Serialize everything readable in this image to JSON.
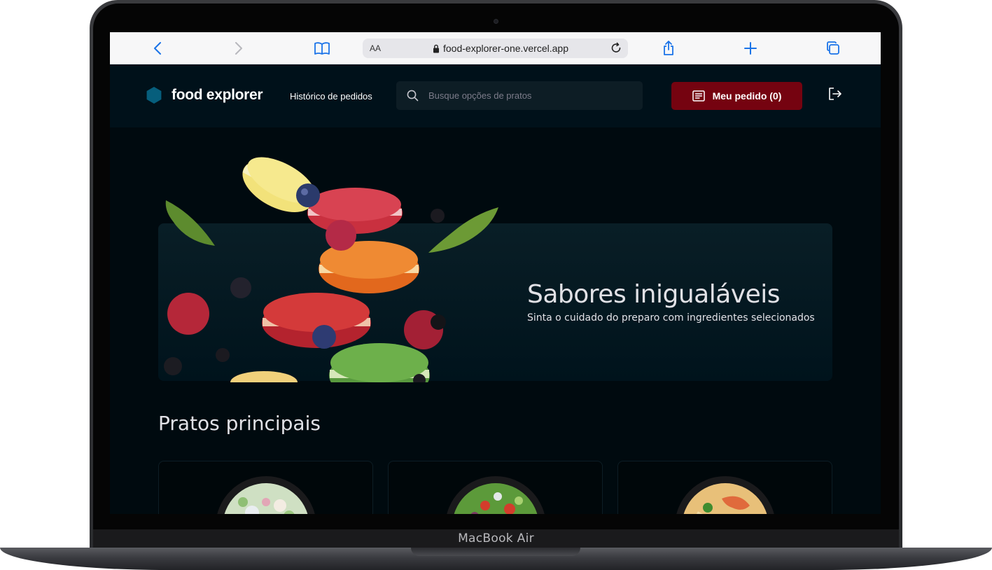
{
  "device": {
    "label": "MacBook Air"
  },
  "browser": {
    "url": "food-explorer-one.vercel.app",
    "text_size_label": "AA",
    "icons": [
      "back-icon",
      "forward-icon",
      "bookmarks-icon",
      "lock-icon",
      "reload-icon",
      "share-icon",
      "new-tab-icon",
      "tabs-icon"
    ]
  },
  "header": {
    "logo_text": "food explorer",
    "nav_history": "Histórico de pedidos",
    "search_placeholder": "Busque opções de pratos",
    "order_button": "Meu pedido (0)"
  },
  "banner": {
    "title": "Sabores inigualáveis",
    "subtitle": "Sinta o cuidado do preparo com ingredientes selecionados"
  },
  "section": {
    "title": "Pratos principais",
    "dishes": [
      {
        "image": "salad-bowl"
      },
      {
        "image": "green-salad-bowl"
      },
      {
        "image": "shrimp-pasta-bowl"
      }
    ]
  },
  "colors": {
    "background": "#000a0f",
    "header": "#00111a",
    "accent_red": "#750310",
    "logo_blue": "#065e7c"
  }
}
